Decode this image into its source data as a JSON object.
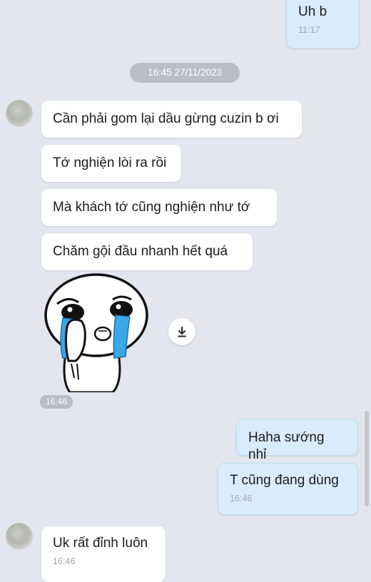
{
  "chat": {
    "top_message": {
      "text": "Uh b",
      "time": "11:17"
    },
    "date_separator": "16:45 27/11/2023",
    "incoming_group": {
      "messages": [
        "Cần phải gom lại dầu gừng cuzin b ơi",
        "Tớ nghiện lòi ra rồi",
        "Mà khách tớ cũng nghiện như tớ",
        "Chăm gội đầu nhanh hết quá"
      ],
      "sticker": "crying-face-sticker",
      "sticker_time": "16:46"
    },
    "outgoing_group": {
      "messages": [
        "Haha sướng nhỉ",
        "T cũng đang dùng"
      ],
      "time": "16:46"
    },
    "last_incoming": {
      "text": "Uk rất đỉnh luôn",
      "time": "16:46"
    }
  },
  "icons": {
    "download": "download-icon"
  },
  "colors": {
    "background": "#e3e6ee",
    "incoming_bubble": "#ffffff",
    "outgoing_bubble": "#d9ecfb",
    "timestamp": "#a3a9b3",
    "chip": "#b9bdc7"
  }
}
